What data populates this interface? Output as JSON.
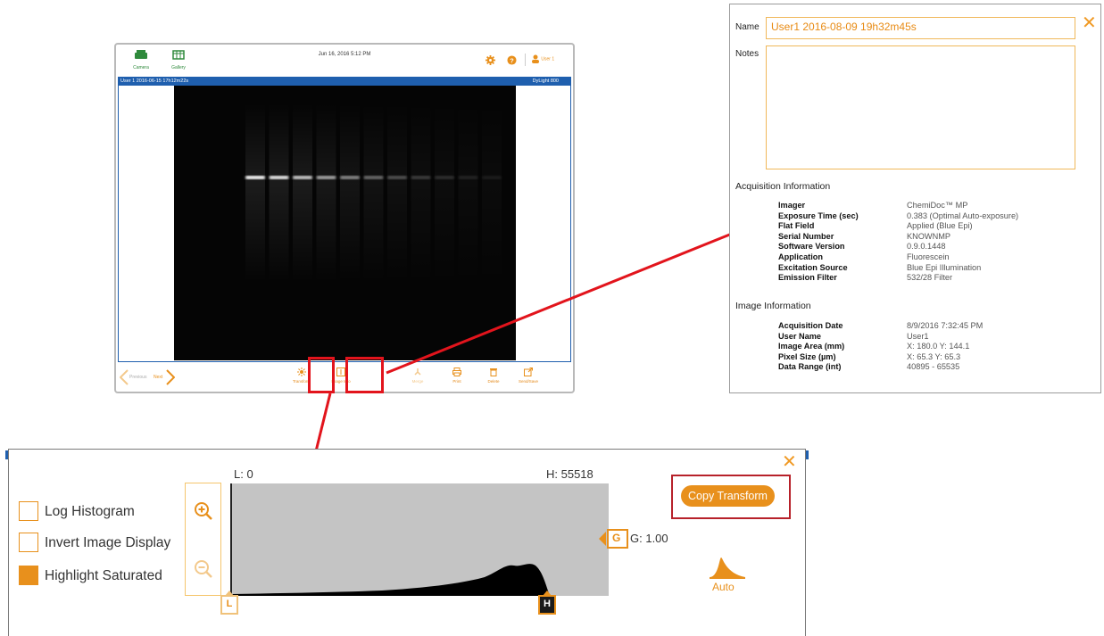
{
  "app": {
    "camera_label": "Camera",
    "gallery_label": "Gallery",
    "datetime": "Jun 16, 2016  5:12 PM",
    "user_label": "User 1",
    "image_title": "User 1 2016-06-15 17h12m22s",
    "channel": "DyLight 800",
    "previous_label": "Previous",
    "next_label": "Next",
    "bottom_buttons": [
      {
        "label": "Transform",
        "icon": "sun-icon"
      },
      {
        "label": "Image Info",
        "icon": "info-icon"
      },
      {
        "label": "Merge",
        "icon": "merge-icon"
      },
      {
        "label": "Print",
        "icon": "print-icon"
      },
      {
        "label": "Delete",
        "icon": "trash-icon"
      },
      {
        "label": "Send/Save",
        "icon": "export-icon"
      }
    ],
    "band_intensities": [
      1.0,
      0.92,
      0.78,
      0.62,
      0.5,
      0.38,
      0.28,
      0.2,
      0.14,
      0.1,
      0.07
    ]
  },
  "info_panel": {
    "name_label": "Name",
    "name_value": "User1 2016-08-09 19h32m45s",
    "notes_label": "Notes",
    "notes_value": "",
    "acq_heading": "Acquisition Information",
    "acquisition": [
      {
        "key": "Imager",
        "value": "ChemiDoc™ MP"
      },
      {
        "key": "Exposure Time (sec)",
        "value": "0.383 (Optimal Auto-exposure)"
      },
      {
        "key": "Flat Field",
        "value": "Applied (Blue Epi)"
      },
      {
        "key": "Serial Number",
        "value": "KNOWNMP"
      },
      {
        "key": "Software Version",
        "value": "0.9.0.1448"
      },
      {
        "key": "Application",
        "value": "Fluorescein"
      },
      {
        "key": "Excitation Source",
        "value": "Blue Epi Illumination"
      },
      {
        "key": "Emission Filter",
        "value": "532/28 Filter"
      }
    ],
    "img_heading": "Image Information",
    "image_info": [
      {
        "key": "Acquisition Date",
        "value": "8/9/2016 7:32:45 PM"
      },
      {
        "key": "User Name",
        "value": "User1"
      },
      {
        "key": "Image Area (mm)",
        "value": "X:   180.0  Y:   144.1"
      },
      {
        "key": "Pixel Size (µm)",
        "value": "X:    65.3  Y:    65.3"
      },
      {
        "key": "Data Range (int)",
        "value": "40895 - 65535"
      }
    ]
  },
  "transform_panel": {
    "options": [
      {
        "label": "Log Histogram",
        "checked": false
      },
      {
        "label": "Invert Image Display",
        "checked": false
      },
      {
        "label": "Highlight Saturated",
        "checked": true
      }
    ],
    "low_label": "L: 0",
    "high_label": "H: 55518",
    "gamma_label": "G: 1.00",
    "l_marker": "L",
    "h_marker": "H",
    "g_marker": "G",
    "copy_transform_label": "Copy Transform",
    "auto_label": "Auto"
  },
  "colors": {
    "accent": "#e8901c",
    "title_bar": "#1f5fae",
    "highlight_red": "#e2141c",
    "histogram_bg": "#c4c4c4"
  }
}
